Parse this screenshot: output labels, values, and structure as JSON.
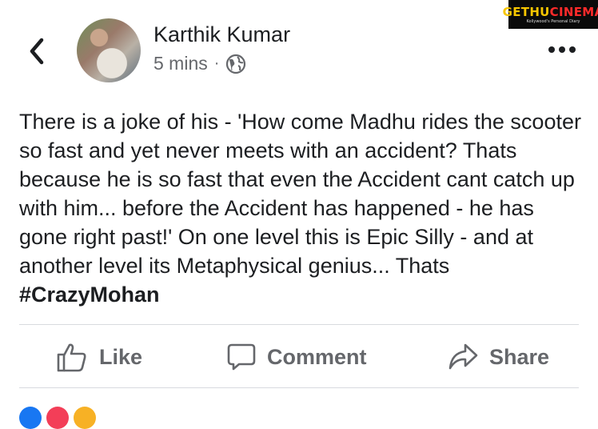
{
  "post": {
    "author": "Karthik Kumar",
    "time": "5 mins",
    "separator": "·",
    "text_before_hashtag": "There is a joke of his - 'How come Madhu rides the scooter so fast and yet never meets with an accident? Thats because he is so fast that even the Accident cant catch up with him... before the Accident has happened - he has gone right past!' On one level this is Epic Silly - and at another level its Metaphysical genius... Thats ",
    "hashtag": "#CrazyMohan"
  },
  "watermark": {
    "part1": "GETHU",
    "part2": "CINEMA",
    "tagline": "Kollywood's Personal Diary"
  },
  "actions": {
    "like_label": "Like",
    "comment_label": "Comment",
    "share_label": "Share"
  },
  "icons": {
    "back": "chevron-left-icon",
    "privacy": "globe-icon",
    "more": "more-horizontal-icon",
    "like": "thumbs-up-icon",
    "comment": "speech-bubble-icon",
    "share": "share-arrow-icon"
  },
  "colors": {
    "text": "#1c1e21",
    "muted": "#65676b",
    "divider": "#d8dadf",
    "watermark_yellow": "#f7c600",
    "watermark_red": "#ff2a2a",
    "reaction_blue": "#1877f2",
    "reaction_red": "#f33e58",
    "reaction_yellow": "#f7b125"
  }
}
